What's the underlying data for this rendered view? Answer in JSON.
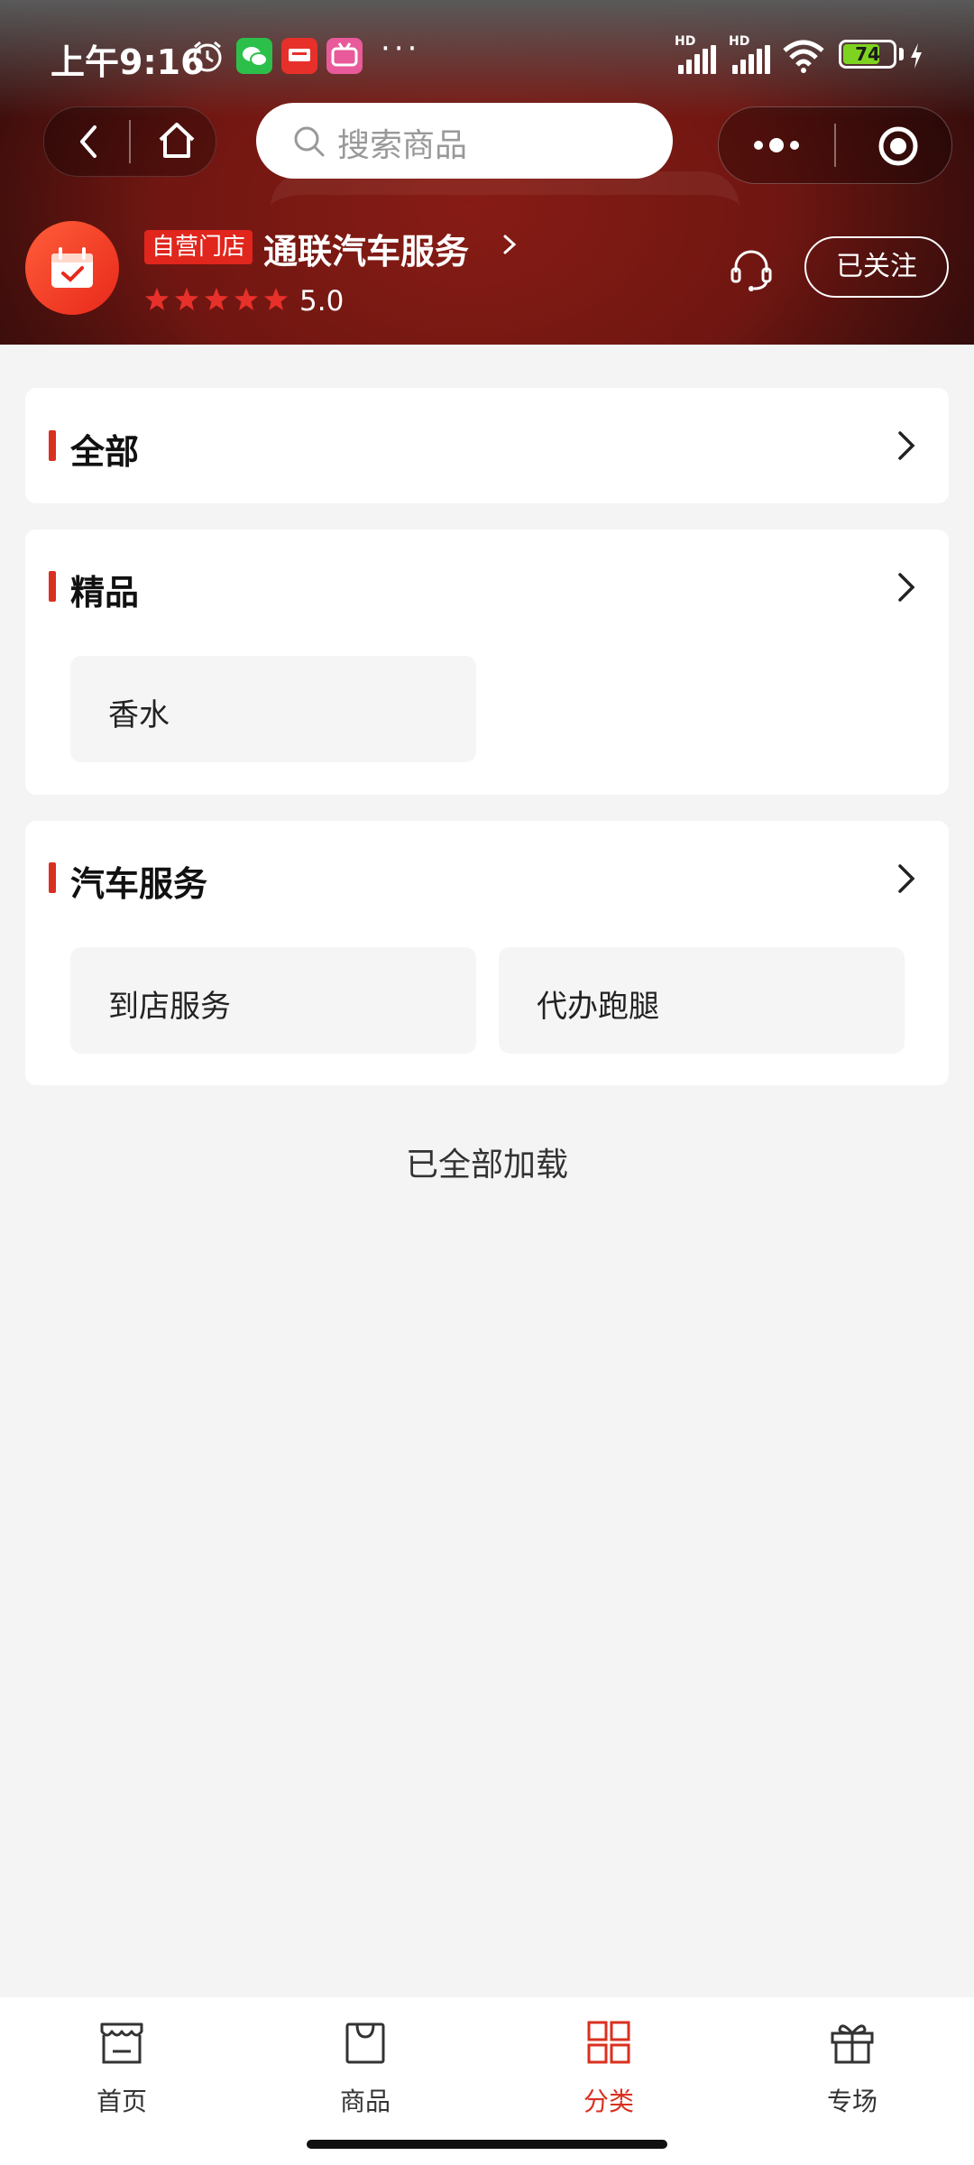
{
  "status_bar": {
    "time": "上午9:16",
    "battery": "74",
    "network_left": "HD",
    "network_right": "HD",
    "more": "···"
  },
  "search": {
    "placeholder": "搜索商品"
  },
  "shop": {
    "badge": "自营门店",
    "name": "通联汽车服务",
    "rating": "5.0",
    "stars": 5,
    "follow_label": "已关注"
  },
  "categories": [
    {
      "title": "全部",
      "items": []
    },
    {
      "title": "精品",
      "items": [
        "香水"
      ]
    },
    {
      "title": "汽车服务",
      "items": [
        "到店服务",
        "代办跑腿"
      ]
    }
  ],
  "footer_text": "已全部加载",
  "tabbar": [
    {
      "label": "首页",
      "icon": "store-icon",
      "active": false
    },
    {
      "label": "商品",
      "icon": "bag-icon",
      "active": false
    },
    {
      "label": "分类",
      "icon": "grid-icon",
      "active": true
    },
    {
      "label": "专场",
      "icon": "gift-icon",
      "active": false
    }
  ],
  "colors": {
    "accent": "#d9301f",
    "header_bg": "#8a1c16",
    "battery": "#7ed321"
  }
}
